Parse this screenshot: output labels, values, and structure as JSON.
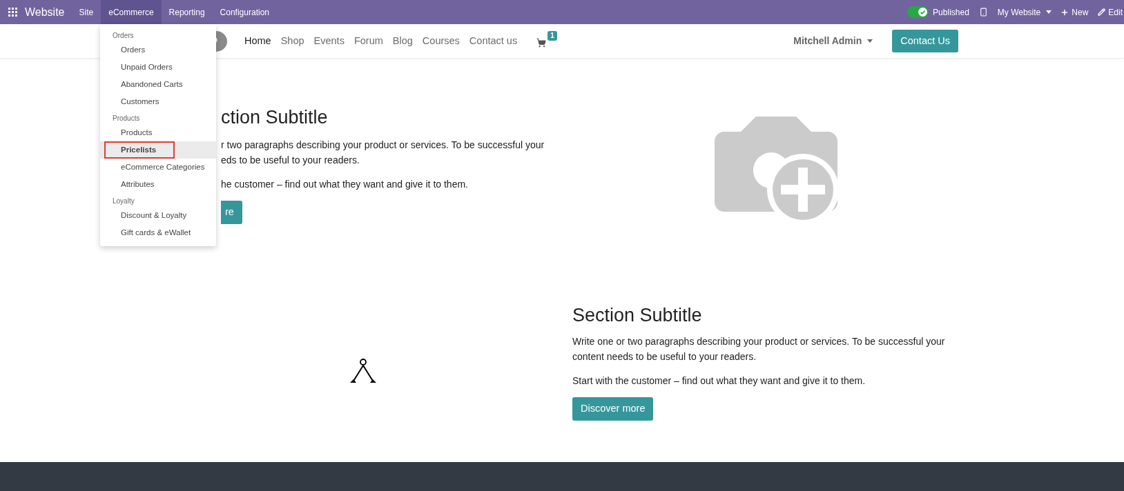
{
  "topbar": {
    "app_title": "Website",
    "menus": [
      {
        "label": "Site",
        "selected": false
      },
      {
        "label": "eCommerce",
        "selected": true
      },
      {
        "label": "Reporting",
        "selected": false
      },
      {
        "label": "Configuration",
        "selected": false
      }
    ],
    "published": {
      "label": "Published",
      "on": true
    },
    "website": "My Website",
    "new": "New",
    "edit": "Edit"
  },
  "header": {
    "nav": [
      {
        "label": "Home",
        "selected": true
      },
      {
        "label": "Shop",
        "selected": false
      },
      {
        "label": "Events",
        "selected": false
      },
      {
        "label": "Forum",
        "selected": false
      },
      {
        "label": "Blog",
        "selected": false
      },
      {
        "label": "Courses",
        "selected": false
      },
      {
        "label": "Contact us",
        "selected": false
      }
    ],
    "cart_count": "1",
    "user": "Mitchell Admin",
    "cta": "Contact Us"
  },
  "dropdown": {
    "groups": [
      {
        "title": "Orders",
        "items": [
          {
            "label": "Orders",
            "selected": false
          },
          {
            "label": "Unpaid Orders",
            "selected": false
          },
          {
            "label": "Abandoned Carts",
            "selected": false
          },
          {
            "label": "Customers",
            "selected": false
          }
        ]
      },
      {
        "title": "Products",
        "items": [
          {
            "label": "Products",
            "selected": false
          },
          {
            "label": "Pricelists",
            "selected": true
          },
          {
            "label": "eCommerce Categories",
            "selected": false
          },
          {
            "label": "Attributes",
            "selected": false
          }
        ]
      },
      {
        "title": "Loyalty",
        "items": [
          {
            "label": "Discount & Loyalty",
            "selected": false
          },
          {
            "label": "Gift cards & eWallet",
            "selected": false
          }
        ]
      }
    ]
  },
  "section_1": {
    "heading": "ction Subtitle",
    "paragraph_1_lines": [
      "r two paragraphs describing your product or services. To be successful your",
      "eds to be useful to your readers."
    ],
    "paragraph_2": "he customer – find out what they want and give it to them.",
    "button": "re"
  },
  "section_2": {
    "heading": "Section Subtitle",
    "paragraph_1": "Write one or two paragraphs describing your product or services. To be successful your content needs to be useful to your readers.",
    "paragraph_2": "Start with the customer – find out what they want and give it to them.",
    "button": "Discover more"
  }
}
